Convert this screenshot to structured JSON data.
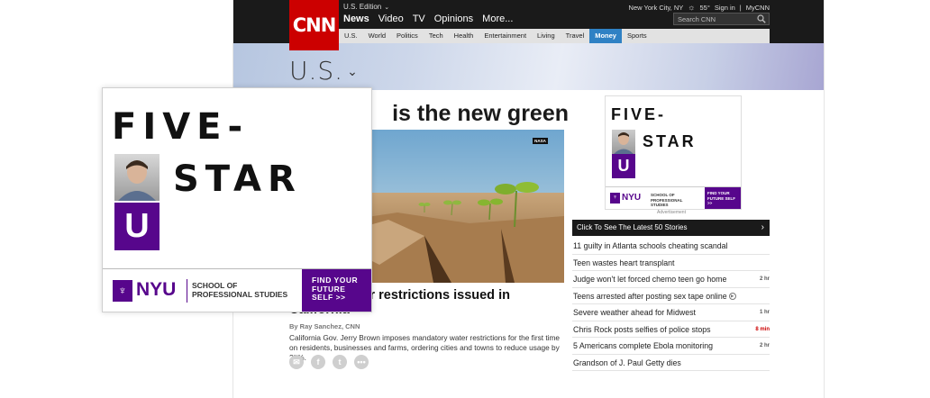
{
  "header": {
    "logo": "CNN",
    "edition": "U.S. Edition",
    "nav": [
      {
        "label": "News",
        "active": true
      },
      {
        "label": "Video",
        "active": false
      },
      {
        "label": "TV",
        "active": false
      },
      {
        "label": "Opinions",
        "active": false
      },
      {
        "label": "More...",
        "active": false
      }
    ],
    "location": "New York City, NY",
    "temperature": "55°",
    "sign_in": "Sign in",
    "separator": "|",
    "mycnn": "MyCNN",
    "search_placeholder": "Search CNN"
  },
  "subnav": [
    {
      "label": "U.S.",
      "active": false
    },
    {
      "label": "World",
      "active": false
    },
    {
      "label": "Politics",
      "active": false
    },
    {
      "label": "Tech",
      "active": false
    },
    {
      "label": "Health",
      "active": false
    },
    {
      "label": "Entertainment",
      "active": false
    },
    {
      "label": "Living",
      "active": false
    },
    {
      "label": "Travel",
      "active": false
    },
    {
      "label": "Money",
      "active": true
    },
    {
      "label": "Sports",
      "active": false
    }
  ],
  "section": {
    "title": "U.S."
  },
  "story": {
    "headline": "is the new green",
    "photo_badge": "NASA",
    "title": "ndatory water restrictions issued in California",
    "byline": "By Ray Sanchez, CNN",
    "summary": "California Gov. Jerry Brown imposes mandatory water restrictions for the first time on residents, businesses and farms, ordering cities and towns to reduce usage by 25%."
  },
  "ad": {
    "line1": "FIVE-",
    "line2": "STAR",
    "u": "U",
    "brand": "NYU",
    "school": "SCHOOL OF PROFESSIONAL STUDIES",
    "cta": "FIND YOUR FUTURE SELF >>",
    "label": "Advertisement"
  },
  "latest": {
    "header": "Click To See The Latest 50 Stories",
    "items": [
      {
        "text": "11 guilty in Atlanta schools cheating scandal",
        "time": "",
        "video": false,
        "red": false
      },
      {
        "text": "Teen wastes heart transplant",
        "time": "",
        "video": false,
        "red": false
      },
      {
        "text": "Judge won't let forced chemo teen go home",
        "time": "2 hr",
        "video": false,
        "red": false
      },
      {
        "text": "Teens arrested after posting sex tape online",
        "time": "",
        "video": true,
        "red": false
      },
      {
        "text": "Severe weather ahead for Midwest",
        "time": "1 hr",
        "video": false,
        "red": false
      },
      {
        "text": "Chris Rock posts selfies of police stops",
        "time": "8 min",
        "video": false,
        "red": true
      },
      {
        "text": "5 Americans complete Ebola monitoring",
        "time": "2 hr",
        "video": false,
        "red": false
      },
      {
        "text": "Grandson of J. Paul Getty dies",
        "time": "",
        "video": false,
        "red": false
      }
    ]
  },
  "colors": {
    "cnn_red": "#cc0000",
    "nyu_purple": "#57068c",
    "active_tab": "#2f81c4"
  }
}
